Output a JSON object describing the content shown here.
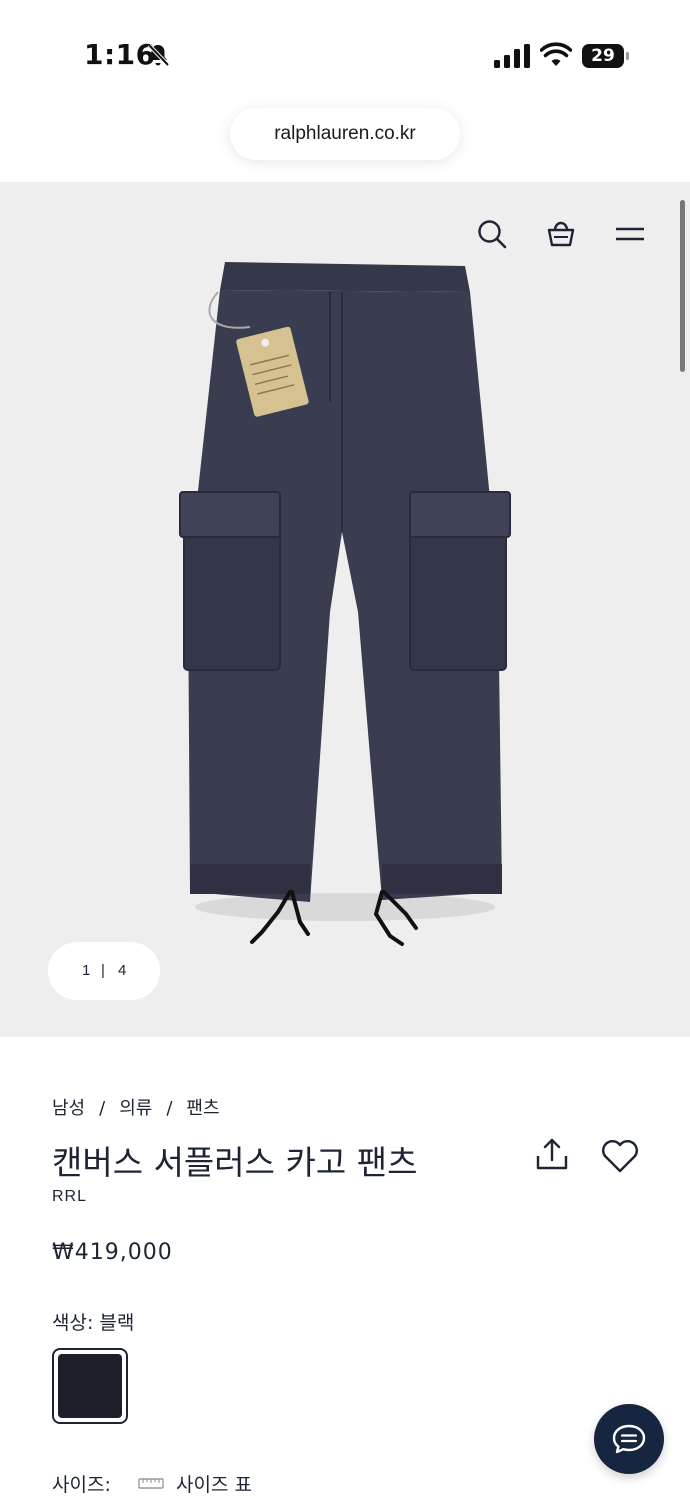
{
  "status_bar": {
    "time": "1:16",
    "battery": "29"
  },
  "browser": {
    "url": "ralphlauren.co.kr"
  },
  "gallery": {
    "current": "1",
    "separator": "|",
    "total": "4"
  },
  "breadcrumb": {
    "level1": "남성",
    "level2": "의류",
    "level3": "팬츠",
    "separator": "/"
  },
  "product": {
    "title": "캔버스 서플러스 카고 팬츠",
    "brand": "RRL",
    "price": "₩419,000",
    "color_label": "색상: 블랙",
    "size_label": "사이즈:",
    "size_chart_link": "사이즈 표"
  },
  "icons": {
    "search": "search-icon",
    "bag": "shopping-bag-icon",
    "menu": "hamburger-menu-icon",
    "share": "share-icon",
    "wishlist": "heart-icon",
    "chat": "chat-icon",
    "ruler": "ruler-icon"
  },
  "colors": {
    "navy": "#162540",
    "text": "#1d2433",
    "hero_bg": "#eeeeee",
    "swatch": "#1f1f2b"
  }
}
